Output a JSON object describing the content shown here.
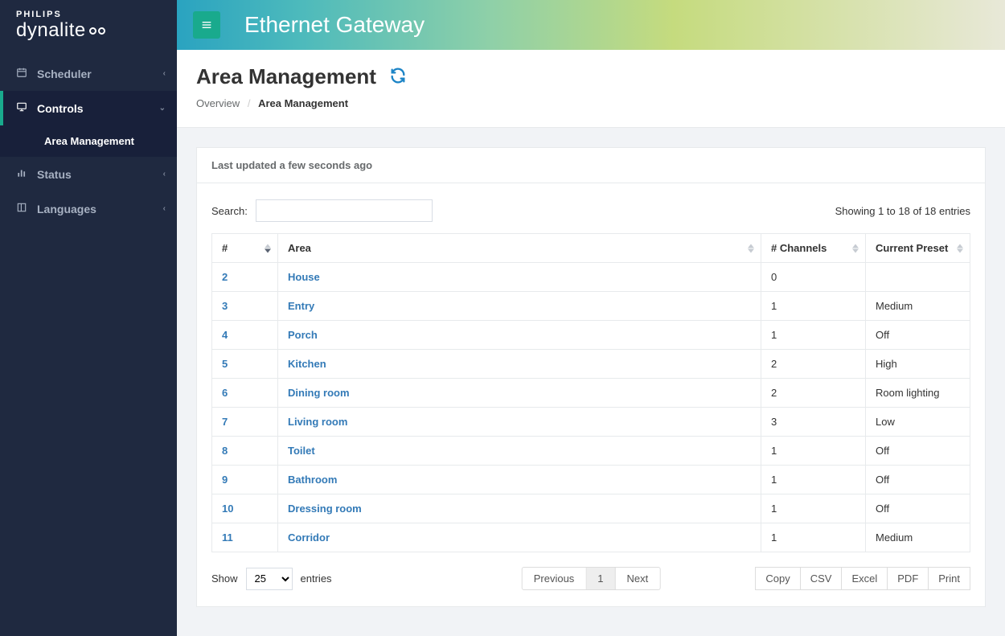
{
  "logo": {
    "brand": "PHILIPS",
    "product": "dynalite"
  },
  "header": {
    "app_title": "Ethernet Gateway"
  },
  "sidebar": {
    "items": [
      {
        "label": "Scheduler",
        "icon": "calendar-icon"
      },
      {
        "label": "Controls",
        "icon": "monitor-icon"
      },
      {
        "label": "Status",
        "icon": "bar-chart-icon"
      },
      {
        "label": "Languages",
        "icon": "book-icon"
      }
    ],
    "sub_active": "Area Management"
  },
  "page": {
    "title": "Area Management",
    "breadcrumb": {
      "overview": "Overview",
      "current": "Area Management"
    },
    "last_updated": "Last updated a few seconds ago"
  },
  "table": {
    "search_label": "Search:",
    "info": "Showing 1 to 18 of 18 entries",
    "columns": {
      "num": "#",
      "area": "Area",
      "channels": "# Channels",
      "preset": "Current Preset"
    },
    "rows": [
      {
        "num": "2",
        "area": "House",
        "channels": "0",
        "preset": ""
      },
      {
        "num": "3",
        "area": "Entry",
        "channels": "1",
        "preset": "Medium"
      },
      {
        "num": "4",
        "area": "Porch",
        "channels": "1",
        "preset": "Off"
      },
      {
        "num": "5",
        "area": "Kitchen",
        "channels": "2",
        "preset": "High"
      },
      {
        "num": "6",
        "area": "Dining room",
        "channels": "2",
        "preset": "Room lighting"
      },
      {
        "num": "7",
        "area": "Living room",
        "channels": "3",
        "preset": "Low"
      },
      {
        "num": "8",
        "area": "Toilet",
        "channels": "1",
        "preset": "Off"
      },
      {
        "num": "9",
        "area": "Bathroom",
        "channels": "1",
        "preset": "Off"
      },
      {
        "num": "10",
        "area": "Dressing room",
        "channels": "1",
        "preset": "Off"
      },
      {
        "num": "11",
        "area": "Corridor",
        "channels": "1",
        "preset": "Medium"
      }
    ]
  },
  "footer": {
    "show": "Show",
    "entries": "entries",
    "page_size": "25",
    "paginate": {
      "prev": "Previous",
      "page": "1",
      "next": "Next"
    },
    "export": [
      "Copy",
      "CSV",
      "Excel",
      "PDF",
      "Print"
    ]
  }
}
